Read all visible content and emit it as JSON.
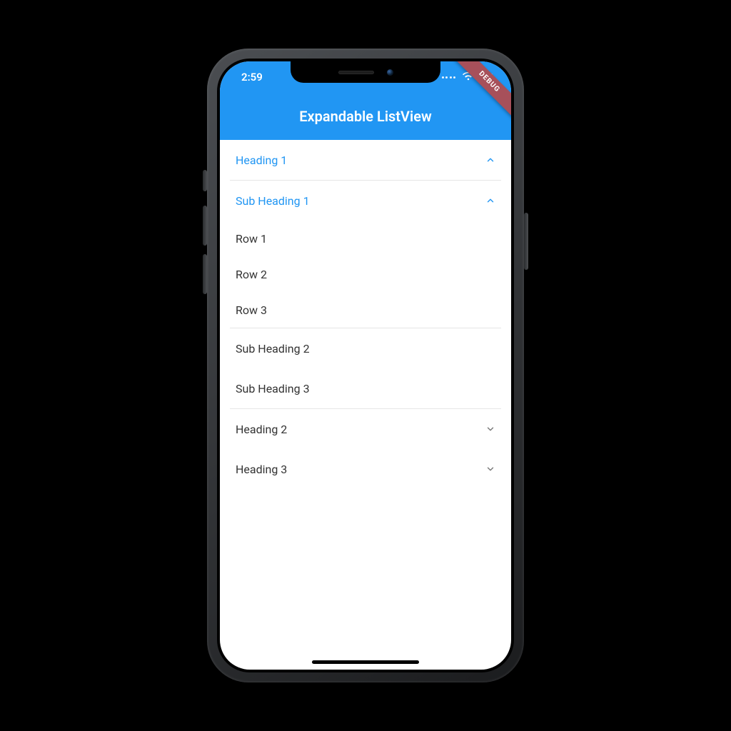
{
  "statusbar": {
    "time": "2:59"
  },
  "debug_banner": "DEBUG",
  "appbar": {
    "title": "Expandable ListView"
  },
  "list": {
    "heading1": {
      "label": "Heading 1"
    },
    "subheading1": {
      "label": "Sub Heading 1"
    },
    "rows": [
      {
        "label": "Row 1"
      },
      {
        "label": "Row 2"
      },
      {
        "label": "Row 3"
      }
    ],
    "subheading2": {
      "label": "Sub Heading 2"
    },
    "subheading3": {
      "label": "Sub Heading 3"
    },
    "heading2": {
      "label": "Heading 2"
    },
    "heading3": {
      "label": "Heading 3"
    }
  },
  "colors": {
    "accent": "#2196f3",
    "debug_banner_bg": "#a7505a"
  }
}
